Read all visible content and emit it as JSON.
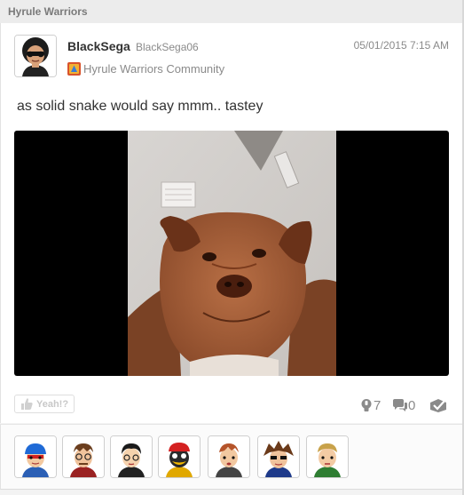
{
  "header": {
    "title": "Hyrule Warriors"
  },
  "post": {
    "display_name": "BlackSega",
    "user_id": "BlackSega06",
    "timestamp": "05/01/2015 7:15 AM",
    "community": "Hyrule Warriors Community",
    "body": "as solid snake would say mmm.. tastey"
  },
  "actions": {
    "yeah_label": "Yeah!?",
    "yeah_count": "7",
    "comment_count": "0"
  },
  "icons": {
    "yeah": "yeah-hand-icon",
    "yeah_count": "hand-icon",
    "comments": "speech-bubble-icon",
    "spoiler": "check-box-icon"
  },
  "colors": {
    "header_bg": "#ececec",
    "muted_text": "#8a8a8a",
    "body_text": "#323232",
    "media_bg": "#000000"
  }
}
